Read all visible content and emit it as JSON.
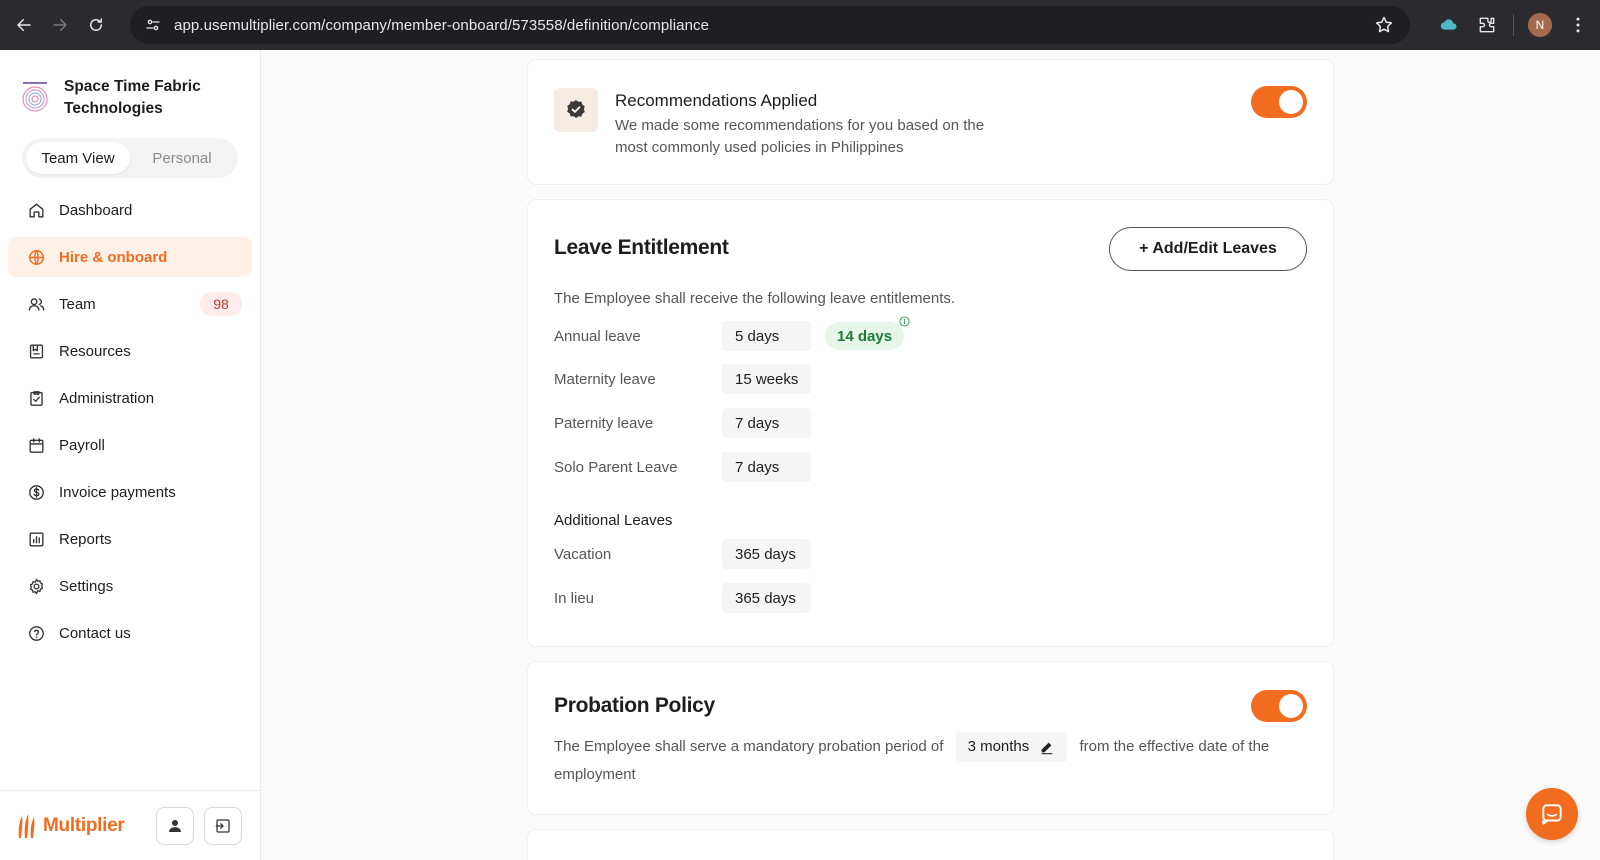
{
  "browser": {
    "url": "app.usemultiplier.com/company/member-onboard/573558/definition/compliance",
    "profile_initial": "N"
  },
  "sidebar": {
    "company_name": "Space Time Fabric Technologies",
    "view_switch": {
      "team": "Team View",
      "personal": "Personal"
    },
    "items": [
      {
        "label": "Dashboard",
        "icon": "home-icon"
      },
      {
        "label": "Hire & onboard",
        "icon": "globe-icon"
      },
      {
        "label": "Team",
        "icon": "users-icon",
        "badge": "98"
      },
      {
        "label": "Resources",
        "icon": "resources-icon"
      },
      {
        "label": "Administration",
        "icon": "clipboard-check-icon"
      },
      {
        "label": "Payroll",
        "icon": "calendar-icon"
      },
      {
        "label": "Invoice payments",
        "icon": "dollar-icon"
      },
      {
        "label": "Reports",
        "icon": "chart-icon"
      },
      {
        "label": "Settings",
        "icon": "gear-icon"
      },
      {
        "label": "Contact us",
        "icon": "help-icon"
      }
    ],
    "brand": "Multiplier"
  },
  "recommendations": {
    "title": "Recommendations Applied",
    "description": "We made some recommendations for you based on the most commonly used policies in Philippines",
    "toggle_on": true
  },
  "leave": {
    "title": "Leave Entitlement",
    "add_button": "+ Add/Edit Leaves",
    "intro": "The Employee shall receive the following leave entitlements.",
    "rows": [
      {
        "label": "Annual leave",
        "value": "5 days",
        "recommended": "14 days"
      },
      {
        "label": "Maternity leave",
        "value": "15 weeks"
      },
      {
        "label": "Paternity leave",
        "value": "7 days"
      },
      {
        "label": "Solo Parent Leave",
        "value": "7 days"
      }
    ],
    "additional_heading": "Additional Leaves",
    "additional": [
      {
        "label": "Vacation",
        "value": "365 days"
      },
      {
        "label": "In lieu",
        "value": "365 days"
      }
    ]
  },
  "probation": {
    "title": "Probation Policy",
    "text_before": "The Employee shall serve a mandatory probation period of",
    "period": "3 months",
    "text_after": "from the effective date of the employment",
    "toggle_on": true
  },
  "colors": {
    "accent": "#f26c1f",
    "recommend_bg": "#e6f6e9",
    "recommend_text": "#1f7a35"
  }
}
